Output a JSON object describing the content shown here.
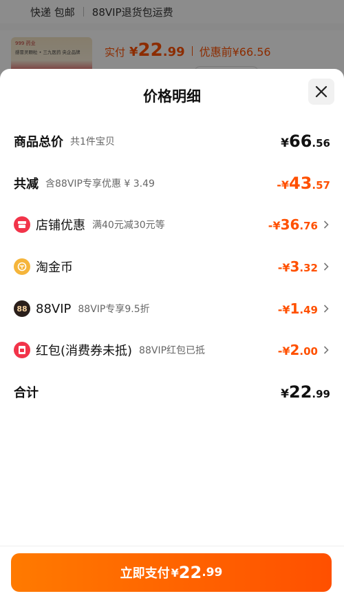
{
  "background": {
    "shipping": {
      "method": "快递 包邮",
      "vip": "88VIP退货包运费"
    },
    "product": {
      "thumb_brand": "999 药业",
      "thumb_text": "感冒灵颗粒 • 三九医药 央企品牌",
      "paid_label": "实付",
      "currency": "¥",
      "paid_int": "22",
      "paid_dec": ".99",
      "before_label": "优惠前¥66.56"
    }
  },
  "sheet": {
    "title": "价格明细",
    "rows": [
      {
        "label": "商品总价",
        "sub": "共1件宝贝",
        "currency": "¥",
        "int": "66",
        "dec": ".56"
      },
      {
        "label": "共减",
        "sub": "含88VIP专享优惠 ¥ 3.49",
        "currency": "-¥",
        "int": "43",
        "dec": ".57"
      },
      {
        "label": "店铺优惠",
        "sub": "满40元减30元等",
        "currency": "-¥",
        "int": "36",
        "dec": ".76",
        "icon": "shop-icon"
      },
      {
        "label": "淘金币",
        "sub": "",
        "currency": "-¥",
        "int": "3",
        "dec": ".32",
        "icon": "coin-icon"
      },
      {
        "label": "88VIP",
        "sub": "88VIP专享9.5折",
        "currency": "-¥",
        "int": "1",
        "dec": ".49",
        "icon": "vip88-icon",
        "icon_text": "88"
      },
      {
        "label": "红包(消费券未抵)",
        "sub": "88VIP红包已抵",
        "currency": "-¥",
        "int": "2",
        "dec": ".00",
        "icon": "red-envelope-icon"
      },
      {
        "label": "合计",
        "sub": "",
        "currency": "¥",
        "int": "22",
        "dec": ".99"
      }
    ]
  },
  "pay_button": {
    "label": "立即支付",
    "currency": "¥",
    "int": "22",
    "dec": ".99"
  },
  "colors": {
    "accent": "#ff5000",
    "shop_icon": "#f2344a",
    "coin_icon": "#f5b53b",
    "vip_icon": "#2a1f1b"
  }
}
